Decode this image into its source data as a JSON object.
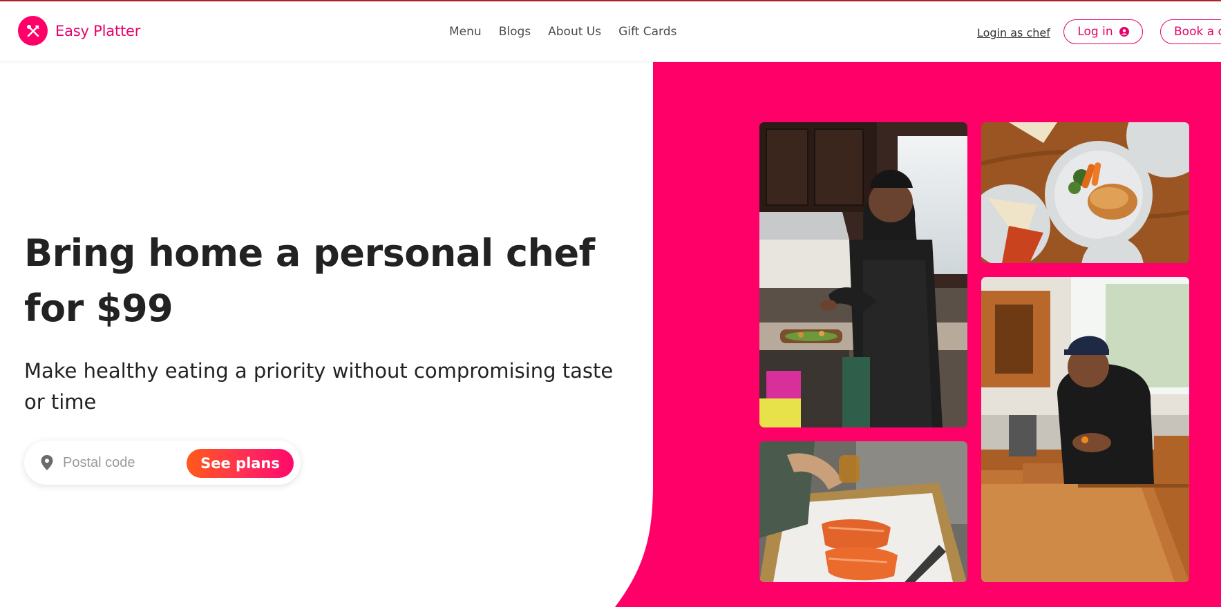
{
  "brand": {
    "name": "Easy Platter"
  },
  "nav": {
    "items": [
      "Menu",
      "Blogs",
      "About Us",
      "Gift Cards"
    ]
  },
  "header_actions": {
    "login_chef": "Login as chef",
    "login": "Log in",
    "book": "Book a chef"
  },
  "hero": {
    "title": "Bring home a personal chef for $99",
    "subtitle": "Make healthy eating a priority without compromising taste or time"
  },
  "search": {
    "placeholder": "Postal code",
    "value": "",
    "button": "See plans"
  },
  "colors": {
    "brand": "#ff0069",
    "brand_text": "#e8006a",
    "button_gradient_start": "#ff5a1a",
    "button_gradient_end": "#ff0a6a"
  },
  "icons": {
    "logo": "fork-knife-icon",
    "login": "user-circle-icon",
    "search": "location-pin-icon"
  }
}
